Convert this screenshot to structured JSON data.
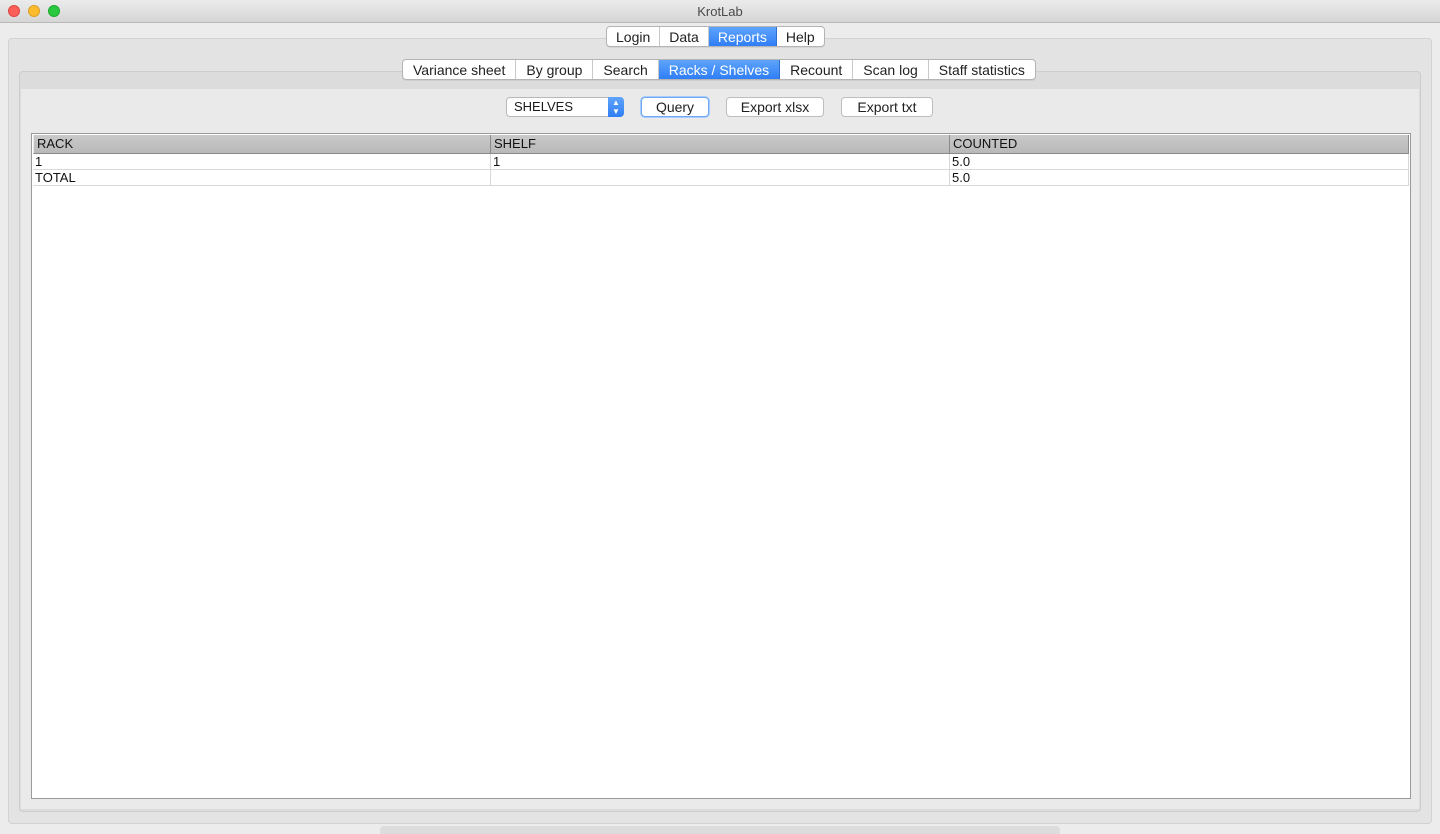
{
  "window": {
    "title": "KrotLab"
  },
  "main_tabs": [
    {
      "label": "Login",
      "active": false
    },
    {
      "label": "Data",
      "active": false
    },
    {
      "label": "Reports",
      "active": true
    },
    {
      "label": "Help",
      "active": false
    }
  ],
  "report_tabs": [
    {
      "label": "Variance sheet",
      "active": false
    },
    {
      "label": "By group",
      "active": false
    },
    {
      "label": "Search",
      "active": false
    },
    {
      "label": "Racks / Shelves",
      "active": true
    },
    {
      "label": "Recount",
      "active": false
    },
    {
      "label": "Scan log",
      "active": false
    },
    {
      "label": "Staff statistics",
      "active": false
    }
  ],
  "toolbar": {
    "mode_select": {
      "value": "SHELVES",
      "icon": "updown-chevron-icon"
    },
    "query_label": "Query",
    "export_xlsx_label": "Export xlsx",
    "export_txt_label": "Export txt"
  },
  "table": {
    "columns": [
      "RACK",
      "SHELF",
      "COUNTED"
    ],
    "rows": [
      [
        "1",
        "1",
        "5.0"
      ],
      [
        "TOTAL",
        "",
        "5.0"
      ]
    ]
  },
  "colors": {
    "accent": "#2f7ef6",
    "close": "#fc5f57",
    "minimize": "#fdbc2e",
    "zoom": "#28c840"
  }
}
